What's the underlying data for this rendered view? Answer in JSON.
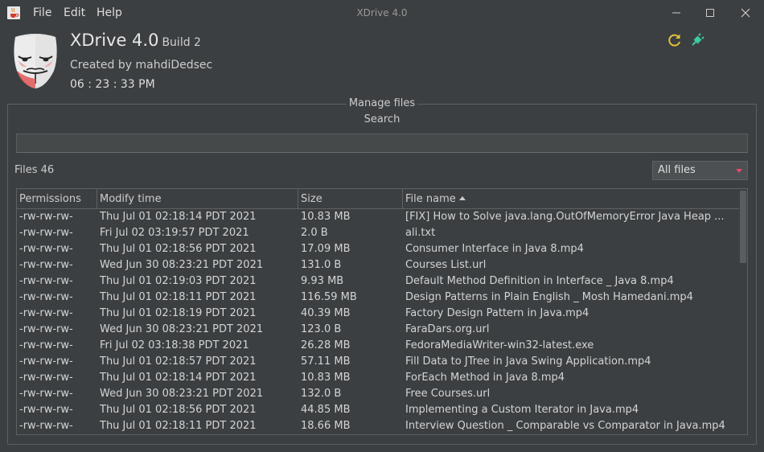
{
  "window": {
    "title": "XDrive 4.0"
  },
  "menu": {
    "file": "File",
    "edit": "Edit",
    "help": "Help"
  },
  "header": {
    "app_name": "XDrive 4.0",
    "build": "Build 2",
    "author": "Created by mahdiDedsec",
    "clock": "06 : 23 : 33 PM"
  },
  "panel": {
    "title": "Manage files",
    "search_label": "Search",
    "search_value": "",
    "files_count": "Files 46",
    "filter": {
      "selected": "All files"
    }
  },
  "table": {
    "columns": [
      "Permissions",
      "Modify time",
      "Size",
      "File name"
    ],
    "rows": [
      [
        "-rw-rw-rw-",
        "Thu Jul 01 02:18:14 PDT 2021",
        "10.83 MB",
        "[FIX] How to Solve java.lang.OutOfMemoryError Java Heap ..."
      ],
      [
        "-rw-rw-rw-",
        "Fri Jul 02 03:19:57 PDT 2021",
        "2.0 B",
        "ali.txt"
      ],
      [
        "-rw-rw-rw-",
        "Thu Jul 01 02:18:56 PDT 2021",
        "17.09 MB",
        "Consumer Interface in Java 8.mp4"
      ],
      [
        "-rw-rw-rw-",
        "Wed Jun 30 08:23:21 PDT 2021",
        "131.0 B",
        "Courses List.url"
      ],
      [
        "-rw-rw-rw-",
        "Thu Jul 01 02:19:03 PDT 2021",
        "9.93 MB",
        "Default Method Definition in Interface _ Java 8.mp4"
      ],
      [
        "-rw-rw-rw-",
        "Thu Jul 01 02:18:11 PDT 2021",
        "116.59 MB",
        "Design Patterns in Plain English _ Mosh Hamedani.mp4"
      ],
      [
        "-rw-rw-rw-",
        "Thu Jul 01 02:18:19 PDT 2021",
        "40.39 MB",
        "Factory Design Pattern in Java.mp4"
      ],
      [
        "-rw-rw-rw-",
        "Wed Jun 30 08:23:21 PDT 2021",
        "123.0 B",
        "FaraDars.org.url"
      ],
      [
        "-rw-rw-rw-",
        "Fri Jul 02 03:18:38 PDT 2021",
        "26.28 MB",
        "FedoraMediaWriter-win32-latest.exe"
      ],
      [
        "-rw-rw-rw-",
        "Thu Jul 01 02:18:57 PDT 2021",
        "57.11 MB",
        "Fill Data to JTree in Java Swing Application.mp4"
      ],
      [
        "-rw-rw-rw-",
        "Thu Jul 01 02:18:14 PDT 2021",
        "10.83 MB",
        "ForEach Method in Java 8.mp4"
      ],
      [
        "-rw-rw-rw-",
        "Wed Jun 30 08:23:21 PDT 2021",
        "132.0 B",
        "Free Courses.url"
      ],
      [
        "-rw-rw-rw-",
        "Thu Jul 01 02:18:56 PDT 2021",
        "44.85 MB",
        "Implementing a Custom Iterator in Java.mp4"
      ],
      [
        "-rw-rw-rw-",
        "Thu Jul 01 02:18:11 PDT 2021",
        "18.66 MB",
        "Interview Question _ Comparable vs Comparator in Java.mp4"
      ]
    ]
  },
  "colors": {
    "background": "#3c3f41",
    "accent_refresh": "#e2c13c",
    "accent_plug": "#3cc9a0",
    "select_arrow": "#e24b68"
  },
  "icons": {
    "app": "java-cup-icon",
    "logo": "anonymous-mask-icon",
    "refresh": "refresh-icon",
    "connect": "plug-icon",
    "sort": "sort-ascending-icon"
  }
}
